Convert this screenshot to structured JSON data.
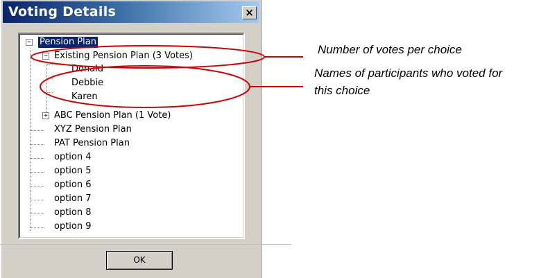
{
  "dialog": {
    "title": "Voting Details",
    "close_glyph": "×",
    "ok_label": "OK"
  },
  "tree": {
    "root": "Pension Plan",
    "choices": [
      {
        "label": "Existing Pension Plan (3 Votes)",
        "expanded": true,
        "voters": [
          "Donald",
          "Debbie",
          "Karen"
        ]
      },
      {
        "label": "ABC Pension Plan (1 Vote)",
        "expanded": false
      },
      {
        "label": "XYZ Pension Plan"
      },
      {
        "label": "PAT Pension Plan"
      },
      {
        "label": "option 4"
      },
      {
        "label": "option 5"
      },
      {
        "label": "option 6"
      },
      {
        "label": "option 7"
      },
      {
        "label": "option 8"
      },
      {
        "label": "option 9"
      }
    ]
  },
  "annotations": {
    "votes_per_choice": "Number of votes per choice",
    "voter_names_line1": "Names of participants who voted for",
    "voter_names_line2": "this choice"
  },
  "colors": {
    "highlight": "#d40000",
    "selection": "#0a246a"
  }
}
